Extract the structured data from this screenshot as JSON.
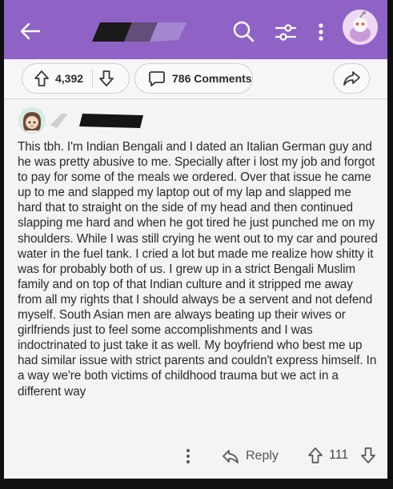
{
  "colors": {
    "header_bg": "#8f63c6",
    "header_icon": "#ffffff",
    "text": "#2a2a2a",
    "muted": "#555555"
  },
  "icons": {
    "back": "arrow-left-icon",
    "search": "search-icon",
    "filter": "sliders-icon",
    "more": "more-vertical-icon",
    "upvote": "arrow-up-icon",
    "downvote": "arrow-down-icon",
    "comments": "comment-bubble-icon",
    "share": "share-arrow-icon",
    "reply": "reply-arrow-icon"
  },
  "post_actions": {
    "score": "4,392",
    "comments_label": "786 Comments"
  },
  "comment": {
    "text": "This tbh. I'm Indian Bengali and I dated an Italian German guy and he was pretty abusive to me. Specially after i lost my job and forgot to pay for some of the meals we ordered. Over that issue he came up to me and slapped my laptop out of my lap and slapped me hard that to straight on the side of my head and then continued slapping me hard and when he got tired he just punched me on my shoulders. While I was still crying he went out to my car and poured water in the fuel tank. I cried a lot but made me realize how shitty it was for probably both of us. I grew up in a strict Bengali Muslim family and on top of that Indian culture and it stripped me away from all my rights that I should always be a servent and not defend myself. South Asian men are always beating up their wives or girlfriends just to feel some accomplishments and I was indoctrinated to just take it as well. My boyfriend who best me up had similar issue with strict parents and couldn't express himself. In a way we're both victims of childhood trauma but we act in a different way",
    "reply_label": "Reply",
    "score": "111"
  }
}
